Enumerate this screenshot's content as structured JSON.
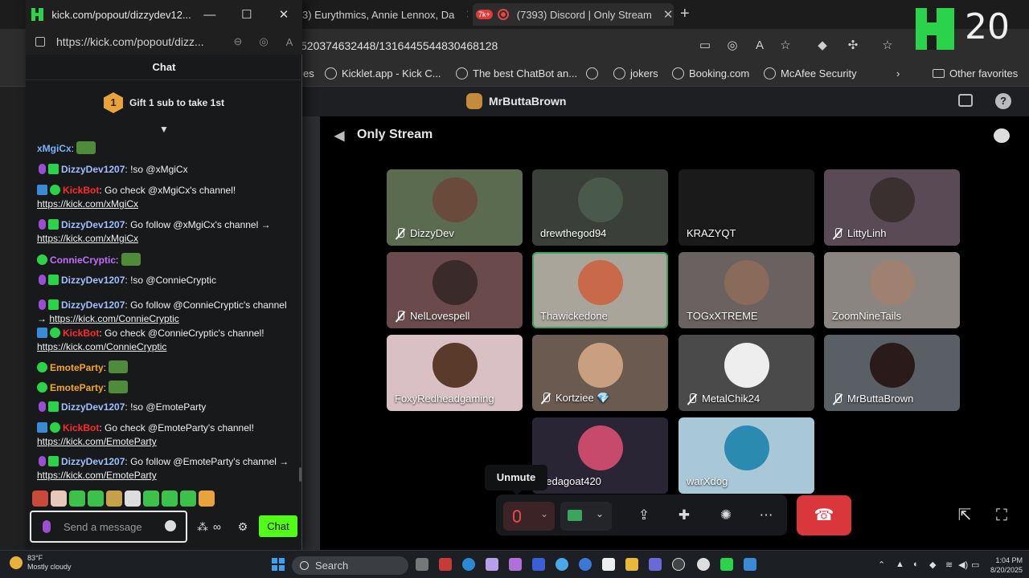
{
  "browser": {
    "tabs": [
      {
        "label": "3) Eurythmics, Annie Lennox, Da",
        "close": "✕"
      },
      {
        "label": "(7393) Discord | Only Stream",
        "badge": "7k+",
        "close": "✕"
      }
    ],
    "new_tab": "+",
    "url_tail": "520374632448/1316445544830468128",
    "bookmarks": [
      "es",
      "Kicklet.app - Kick C...",
      "The best ChatBot an...",
      "jokers",
      "Booking.com",
      "McAfee Security"
    ],
    "other_favorites": "Other favorites",
    "overlay_number": "20"
  },
  "discord": {
    "server_name": "MrButtaBrown",
    "stage_name": "Only Stream",
    "participants": [
      {
        "name": "DizzyDev",
        "muted": true
      },
      {
        "name": "drewthegod94",
        "muted": false
      },
      {
        "name": "KRAZYQT",
        "muted": false
      },
      {
        "name": "LittyLinh",
        "muted": true
      },
      {
        "name": "NelLovespell",
        "muted": true
      },
      {
        "name": "Thawickedone",
        "muted": false
      },
      {
        "name": "TOGxXTREME",
        "muted": false
      },
      {
        "name": "ZoomNineTails",
        "muted": false
      },
      {
        "name": "FoxyRedheadgaming",
        "muted": false
      },
      {
        "name": "Kortziee 💎",
        "muted": true
      },
      {
        "name": "MetalChik24",
        "muted": true
      },
      {
        "name": "MrButtaBrown",
        "muted": true
      },
      {
        "name": "aedagoat420",
        "muted": false
      },
      {
        "name": "warXdog",
        "muted": false
      }
    ],
    "tooltip": "Unmute",
    "colors": {
      "speaking_outline": "#3ba55d",
      "hangup": "#da373c"
    }
  },
  "popout": {
    "title": "kick.com/popout/dizzydev12...",
    "url": "https://kick.com/popout/dizz...",
    "chat_header": "Chat",
    "gift_rank": "1",
    "gift_text": "Gift 1 sub to take 1st",
    "messages": [
      {
        "user": "xMgiCx",
        "text": "",
        "cls": "u-xmgic",
        "badges": [],
        "emote": true
      },
      {
        "user": "DizzyDev1207",
        "text": "!so @xMgiCx",
        "cls": "u-dizzy",
        "badges": [
          "b-mic",
          "b-sub"
        ]
      },
      {
        "user": "KickBot",
        "text": "Go check @xMgiCx's channel!",
        "link": "https://kick.com/xMgiCx",
        "cls": "u-kick",
        "badges": [
          "b-bot",
          "b-ver"
        ]
      },
      {
        "user": "DizzyDev1207",
        "text": "Go follow @xMgiCx's channel →",
        "link": "https://kick.com/xMgiCx",
        "cls": "u-dizzy",
        "badges": [
          "b-mic",
          "b-sub"
        ]
      },
      {
        "user": "ConnieCryptic",
        "text": "",
        "cls": "u-connie",
        "badges": [
          "b-ver"
        ],
        "emote": true
      },
      {
        "user": "DizzyDev1207",
        "text": "!so @ConnieCryptic",
        "cls": "u-dizzy",
        "badges": [
          "b-mic",
          "b-sub"
        ]
      },
      {
        "user": "DizzyDev1207",
        "text": "Go follow @ConnieCryptic's channel → ",
        "link": "https://kick.com/ConnieCryptic",
        "cls": "u-dizzy",
        "badges": [
          "b-mic",
          "b-sub"
        ],
        "inline_link": true
      },
      {
        "user": "KickBot",
        "text": "Go check @ConnieCryptic's channel!",
        "link": "https://kick.com/ConnieCryptic",
        "cls": "u-kick",
        "badges": [
          "b-bot",
          "b-ver"
        ]
      },
      {
        "user": "EmoteParty",
        "text": "",
        "cls": "u-emote",
        "badges": [
          "b-ver"
        ],
        "emote": true
      },
      {
        "user": "EmoteParty",
        "text": "",
        "cls": "u-emote",
        "badges": [
          "b-ver"
        ],
        "emote": true
      },
      {
        "user": "DizzyDev1207",
        "text": "!so @EmoteParty",
        "cls": "u-dizzy",
        "badges": [
          "b-mic",
          "b-sub"
        ]
      },
      {
        "user": "KickBot",
        "text": "Go check @EmoteParty's channel!",
        "link": "https://kick.com/EmoteParty",
        "cls": "u-kick",
        "badges": [
          "b-bot",
          "b-ver"
        ]
      },
      {
        "user": "DizzyDev1207",
        "text": "Go follow @EmoteParty's channel →",
        "link": "https://kick.com/EmoteParty",
        "cls": "u-dizzy",
        "badges": [
          "b-mic",
          "b-sub"
        ]
      }
    ],
    "input_placeholder": "Send a message",
    "send_label": "Chat",
    "colors": {
      "brand": "#53fc18"
    }
  },
  "taskbar": {
    "temp": "83°F",
    "weather": "Mostly cloudy",
    "search": "Search",
    "time": "1:04 PM",
    "date": "8/20/2025"
  }
}
